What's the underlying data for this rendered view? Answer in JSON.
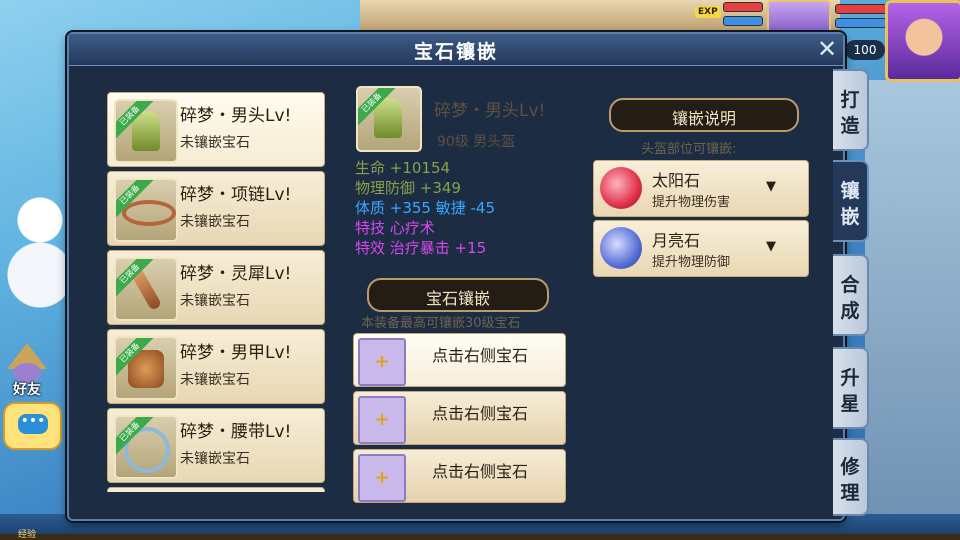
{
  "hud": {
    "exp_badge": "EXP",
    "level": "100",
    "colors": {
      "hp": "#e53f3f",
      "mp": "#3f8fe5",
      "exp": "#f5d64a"
    }
  },
  "side_buttons": {
    "friends": "好友",
    "chat": "•••"
  },
  "bottom": {
    "exp_label": "经验"
  },
  "panel": {
    "title": "宝石镶嵌",
    "close": "✕",
    "equipment_list": [
      {
        "tag": "已装备",
        "name": "碎梦・男头Lv!",
        "status": "未镶嵌宝石",
        "icon": "helmet-icon"
      },
      {
        "tag": "已装备",
        "name": "碎梦・项链Lv!",
        "status": "未镶嵌宝石",
        "icon": "necklace-icon"
      },
      {
        "tag": "已装备",
        "name": "碎梦・灵犀Lv!",
        "status": "未镶嵌宝石",
        "icon": "talisman-icon"
      },
      {
        "tag": "已装备",
        "name": "碎梦・男甲Lv!",
        "status": "未镶嵌宝石",
        "icon": "armor-icon"
      },
      {
        "tag": "已装备",
        "name": "碎梦・腰带Lv!",
        "status": "未镶嵌宝石",
        "icon": "belt-icon"
      }
    ],
    "detail": {
      "tag": "已装备",
      "name": "碎梦・男头Lv!",
      "subtitle": "90级 男头盔",
      "stats": [
        {
          "text": "生命 +10154",
          "style": "base"
        },
        {
          "text": "物理防御 +349",
          "style": "base"
        },
        {
          "text": "体质 +355 敏捷 -45",
          "style": "blue"
        },
        {
          "text": "特技 心疗术",
          "style": "purple"
        },
        {
          "text": "特效 治疗暴击 +15",
          "style": "purple"
        }
      ]
    },
    "socket_section": {
      "title": "宝石镶嵌",
      "hint": "本装备最高可镶嵌30级宝石",
      "slots": [
        {
          "plus": "+",
          "label": "点击右侧宝石"
        },
        {
          "plus": "+",
          "label": "点击右侧宝石"
        },
        {
          "plus": "+",
          "label": "点击右侧宝石"
        }
      ]
    },
    "explain_section": {
      "title": "镶嵌说明",
      "hint": "头盔部位可镶嵌:",
      "gems": [
        {
          "name": "太阳石",
          "desc": "提升物理伤害",
          "caret": "▼",
          "icon": "sun-stone-icon",
          "color": "#e0324a"
        },
        {
          "name": "月亮石",
          "desc": "提升物理防御",
          "caret": "▼",
          "icon": "moon-stone-icon",
          "color": "#5a6fd8"
        }
      ]
    },
    "tabs": [
      {
        "label_1": "打",
        "label_2": "造"
      },
      {
        "label_1": "镶",
        "label_2": "嵌"
      },
      {
        "label_1": "合",
        "label_2": "成"
      },
      {
        "label_1": "升",
        "label_2": "星"
      },
      {
        "label_1": "修",
        "label_2": "理"
      }
    ],
    "active_tab": "镶嵌"
  }
}
